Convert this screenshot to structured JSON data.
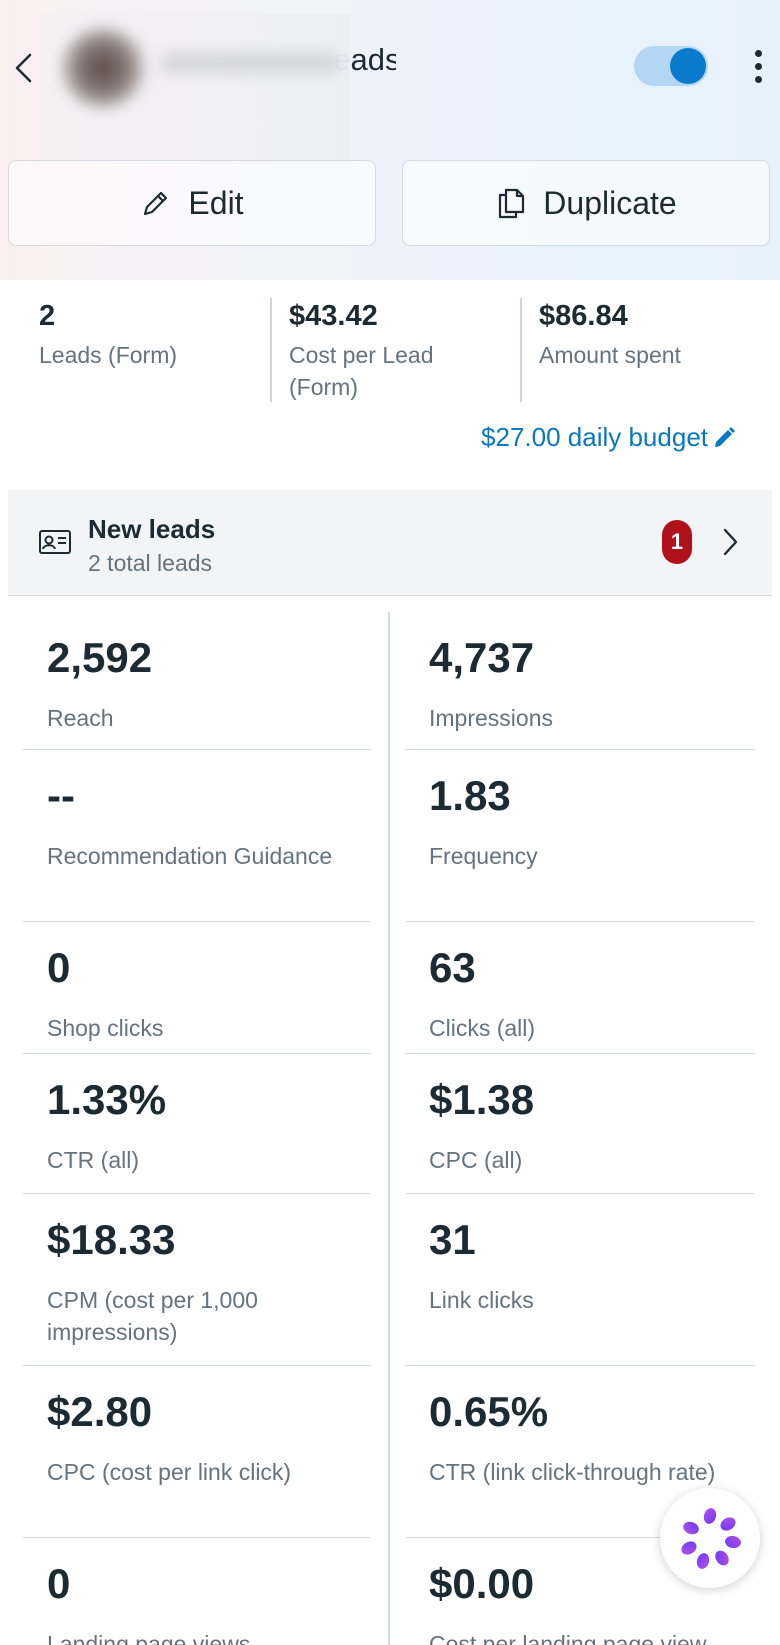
{
  "header": {
    "title_visible_fragment": "Leads",
    "toggle_state": "on",
    "edit_label": "Edit",
    "duplicate_label": "Duplicate"
  },
  "summary": {
    "stats": [
      {
        "value": "2",
        "label": "Leads (Form)"
      },
      {
        "value": "$43.42",
        "label": "Cost per Lead (Form)"
      },
      {
        "value": "$86.84",
        "label": "Amount spent"
      }
    ],
    "budget_label": "$27.00 daily budget"
  },
  "leads": {
    "title": "New leads",
    "subtitle": "2 total leads",
    "badge_count": "1"
  },
  "metrics": [
    {
      "value": "2,592",
      "label": "Reach"
    },
    {
      "value": "4,737",
      "label": "Impressions"
    },
    {
      "value": "--",
      "label": "Recommendation Guidance"
    },
    {
      "value": "1.83",
      "label": "Frequency"
    },
    {
      "value": "0",
      "label": "Shop clicks"
    },
    {
      "value": "63",
      "label": "Clicks (all)"
    },
    {
      "value": "1.33%",
      "label": "CTR (all)"
    },
    {
      "value": "$1.38",
      "label": "CPC (all)"
    },
    {
      "value": "$18.33",
      "label": "CPM (cost per 1,000 impressions)"
    },
    {
      "value": "31",
      "label": "Link clicks"
    },
    {
      "value": "$2.80",
      "label": "CPC (cost per link click)"
    },
    {
      "value": "0.65%",
      "label": "CTR (link click-through rate)"
    },
    {
      "value": "0",
      "label": "Landing page views"
    },
    {
      "value": "$0.00",
      "label": "Cost per landing page view"
    }
  ],
  "colors": {
    "accent": "#0a78be",
    "toggle_knob": "#0a7acc",
    "badge": "#b0121b",
    "text_primary": "#1c2b33",
    "text_secondary": "#65737e"
  },
  "icons": [
    "chevron-left-icon",
    "more-vertical-icon",
    "pencil-icon",
    "duplicate-icon",
    "edit-pencil-icon",
    "id-card-icon",
    "chevron-right-icon",
    "assistant-sparkle-icon"
  ]
}
